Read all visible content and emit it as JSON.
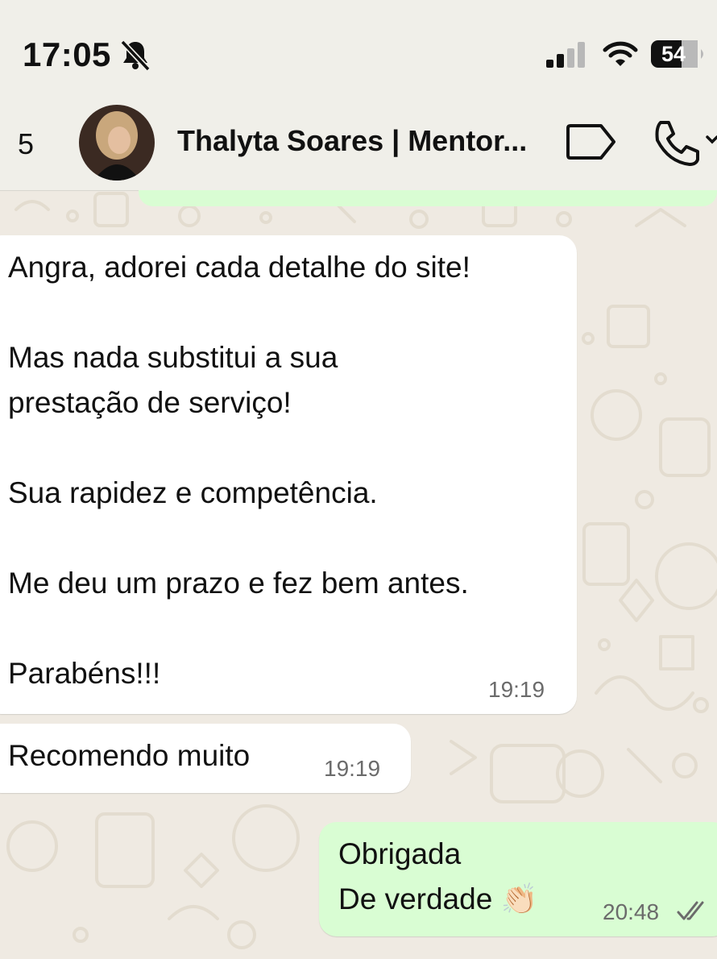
{
  "status_bar": {
    "time": "17:05",
    "battery": "54",
    "icons": [
      "bell-slash-icon",
      "cellular-signal-icon",
      "wifi-icon",
      "battery-icon"
    ]
  },
  "header": {
    "back_count": "5",
    "contact_name": "Thalyta Soares | Mentor...",
    "icons": [
      "avatar",
      "label-icon",
      "phone-call-icon"
    ]
  },
  "messages": [
    {
      "direction": "incoming",
      "lines": [
        "Angra, adorei cada detalhe do site!",
        "",
        "Mas nada substitui a sua",
        "prestação de serviço!",
        "",
        "Sua rapidez e competência.",
        "",
        "Me deu um prazo e fez bem antes.",
        "",
        "Parabéns!!!"
      ],
      "time": "19:19"
    },
    {
      "direction": "incoming",
      "lines": [
        "Recomendo muito"
      ],
      "time": "19:19"
    },
    {
      "direction": "outgoing",
      "lines": [
        "Obrigada",
        "De verdade 👏🏻"
      ],
      "time": "20:48",
      "status_icon": "double-check-icon"
    }
  ],
  "colors": {
    "chat_background": "#efeae2",
    "incoming_bubble": "#ffffff",
    "outgoing_bubble": "#d9fdd3",
    "header_background": "#f0efe9"
  }
}
